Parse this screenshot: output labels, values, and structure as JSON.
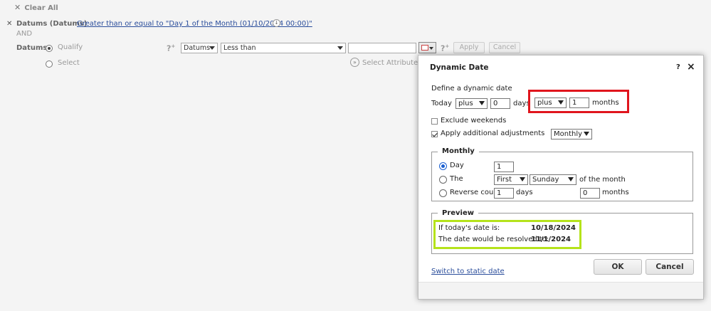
{
  "toolbar": {
    "clear_all": "Clear All"
  },
  "filter": {
    "name": "Datums (Datums)",
    "condition": "Greater than or equal to \"Day 1 of the Month (01/10/2024 00:00)\"",
    "and_label": "AND"
  },
  "editor": {
    "attribute_label": "Datums",
    "qualify_label": "Qualify",
    "select_label": "Select",
    "attr_select": "Datums",
    "operator_select": "Less than",
    "value": "",
    "select_attribute": "Select Attribute...",
    "apply": "Apply",
    "cancel": "Cancel"
  },
  "dialog": {
    "title": "Dynamic Date",
    "help": "?",
    "close": "×",
    "define_label": "Define a dynamic date",
    "today_label": "Today",
    "days_op": "plus",
    "days_value": "0",
    "days_label": "days",
    "months_op": "plus",
    "months_value": "1",
    "months_label": "months",
    "exclude_weekends": "Exclude weekends",
    "apply_adjustments": "Apply additional adjustments",
    "adjust_type": "Monthly",
    "monthly": {
      "legend": "Monthly",
      "day_label": "Day",
      "day_value": "1",
      "the_label": "The",
      "ordinal": "First",
      "weekday": "Sunday",
      "of_month": "of the month",
      "reverse_label": "Reverse count",
      "reverse_days": "1",
      "reverse_days_label": "days",
      "reverse_months": "0",
      "reverse_months_label": "months"
    },
    "preview": {
      "legend": "Preview",
      "today_label": "If today's date is:",
      "today_value": "10/18/2024",
      "resolved_label": "The date would be resolved to:",
      "resolved_value": "11/1/2024"
    },
    "switch_static": "Switch to static date",
    "ok": "OK",
    "cancel": "Cancel"
  },
  "colors": {
    "highlight_red": "#e0151d",
    "highlight_green": "#b5e31b",
    "link": "#2a4d9b"
  }
}
